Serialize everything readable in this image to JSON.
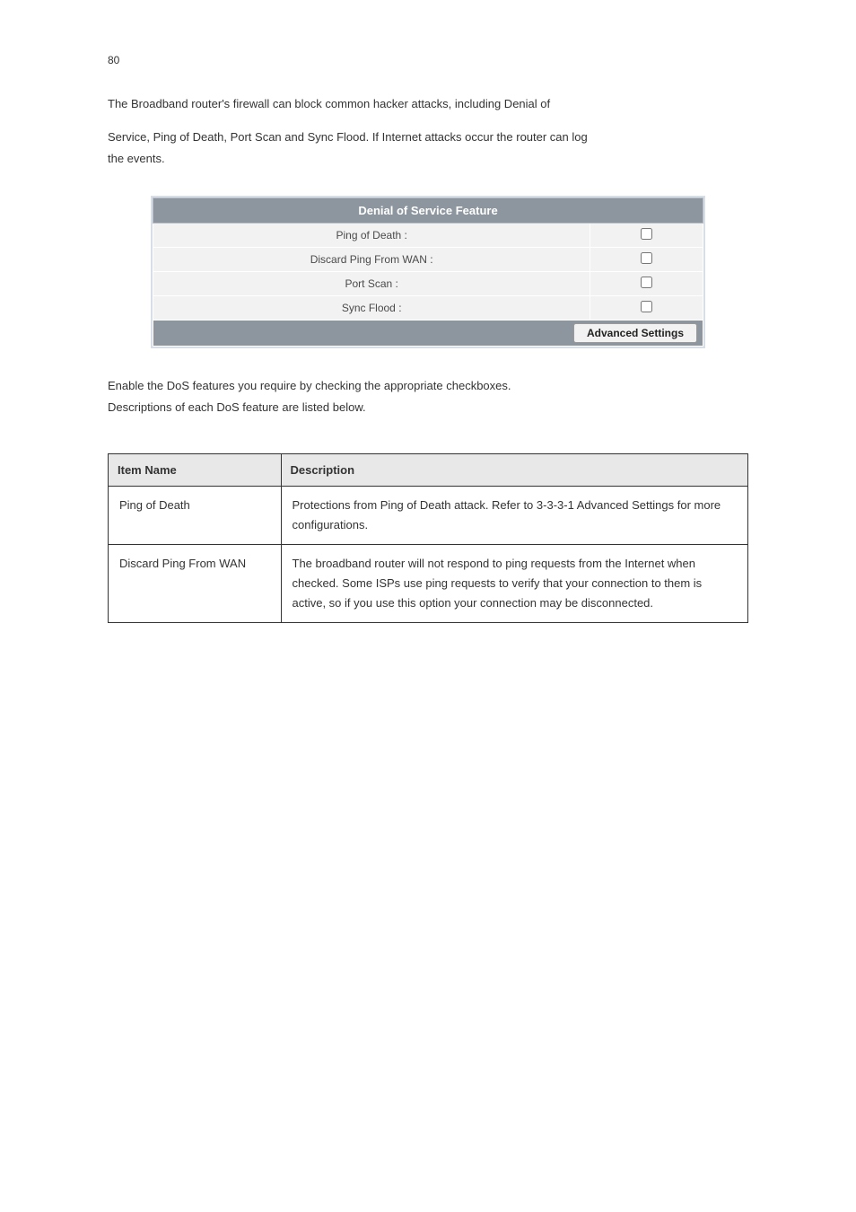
{
  "page_number": "80",
  "intro": {
    "line1": "The Broadband router's firewall can block common hacker attacks, including Denial of",
    "line2": "Service, Ping of Death, Port Scan and Sync Flood. If Internet attacks occur the router can log",
    "line3": "the events."
  },
  "settings_panel": {
    "header": "Denial of Service Feature",
    "rows": [
      {
        "label": "Ping of Death :"
      },
      {
        "label": "Discard Ping From WAN :"
      },
      {
        "label": "Port Scan :"
      },
      {
        "label": "Sync Flood :"
      }
    ],
    "advanced_button": "Advanced Settings"
  },
  "instruction": {
    "line1": "Enable the DoS features you require by checking the appropriate checkboxes.",
    "line2": "Descriptions of each DoS feature are listed below."
  },
  "desc_table": {
    "columns": {
      "item": "Item Name",
      "description": "Description"
    },
    "rows": [
      {
        "item": "Ping of Death",
        "desc": "Protections from Ping of Death attack. Refer to 3-3-3-1 Advanced Settings for more configurations."
      },
      {
        "item": "Discard Ping From WAN",
        "desc": "The broadband router will not respond to ping requests from the Internet when checked. Some ISPs use ping requests to verify that your connection to them is active, so if you use this option your connection may be disconnected."
      }
    ]
  }
}
